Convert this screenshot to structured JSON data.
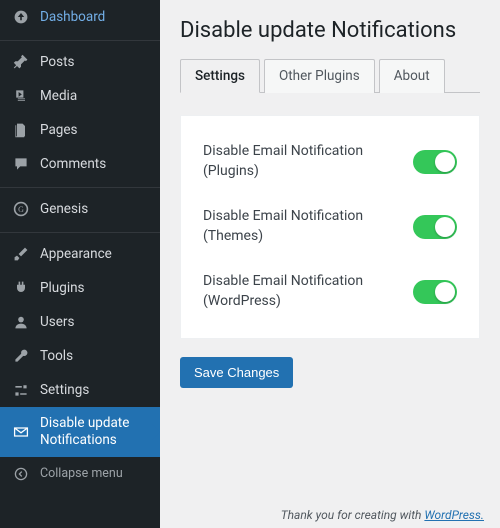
{
  "sidebar": {
    "items": [
      {
        "label": "Dashboard"
      },
      {
        "label": "Posts"
      },
      {
        "label": "Media"
      },
      {
        "label": "Pages"
      },
      {
        "label": "Comments"
      },
      {
        "label": "Genesis"
      },
      {
        "label": "Appearance"
      },
      {
        "label": "Plugins"
      },
      {
        "label": "Users"
      },
      {
        "label": "Tools"
      },
      {
        "label": "Settings"
      },
      {
        "label": "Disable update Notifications"
      }
    ],
    "collapse": "Collapse menu"
  },
  "page": {
    "title": "Disable update Notifications",
    "tabs": [
      {
        "label": "Settings"
      },
      {
        "label": "Other Plugins"
      },
      {
        "label": "About"
      }
    ],
    "settings": [
      {
        "label": "Disable Email Notification (Plugins)",
        "on": true
      },
      {
        "label": "Disable Email Notification (Themes)",
        "on": true
      },
      {
        "label": "Disable Email Notification (WordPress)",
        "on": true
      }
    ],
    "save_label": "Save Changes",
    "footer_text": "Thank you for creating with ",
    "footer_link": "WordPress.",
    "colors": {
      "accent": "#2271b1",
      "toggle_on": "#34c759",
      "sidebar": "#1d2327"
    }
  }
}
